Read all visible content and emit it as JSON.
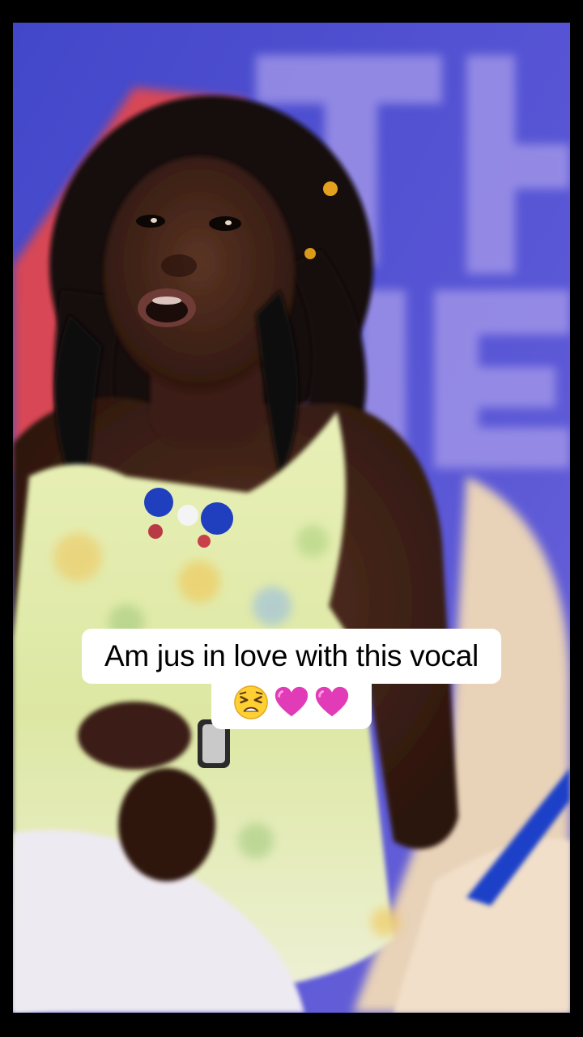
{
  "caption": {
    "line1": "Am jus in love with this vocal",
    "emojis": [
      "tired-face-emoji",
      "pink-heart-emoji",
      "pink-heart-emoji"
    ]
  },
  "colors": {
    "backdrop_blue": "#4d4fd0",
    "backdrop_red": "#e0474f",
    "caption_bg": "#ffffff",
    "caption_text": "#000000",
    "heart_pink": "#e23bb8",
    "dress_green": "#dfe8a6"
  }
}
